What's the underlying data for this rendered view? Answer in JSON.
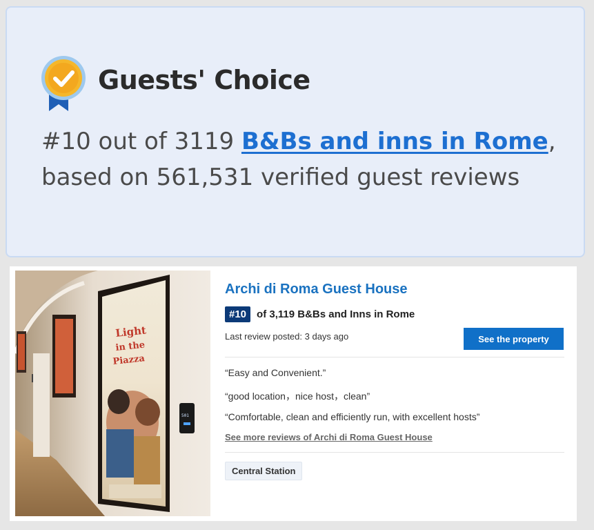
{
  "badge": {
    "title": "Guests' Choice",
    "rank_prefix": "#10 out of 3119 ",
    "category_link": "B&Bs and inns in Rome",
    "rank_suffix": ", based on 561,531 verified guest reviews",
    "colors": {
      "medal_circle": "#f5b72b",
      "medal_ribbon": "#1f5fb6",
      "link": "#1d6fd1"
    },
    "icon": "medal-check-icon"
  },
  "listing": {
    "photo": {
      "poster_title": "Light in the Piazza",
      "door_number": "501"
    },
    "name": "Archi di Roma Guest House",
    "rank_badge": "#10",
    "rank_text": "of 3,119 B&Bs and Inns in Rome",
    "last_review": "Last review posted: 3 days ago",
    "cta_label": "See the property",
    "reviews": [
      "“Easy and Convenient.”",
      "“good location，nice host，clean”",
      "“Comfortable, clean and efficiently run, with excellent hosts”"
    ],
    "more_reviews_link": "See more reviews of Archi di Roma Guest House",
    "tags": [
      "Central Station"
    ],
    "colors": {
      "name": "#1a72c0",
      "rank_badge_bg": "#0c3a78",
      "button": "#1070c8"
    }
  }
}
